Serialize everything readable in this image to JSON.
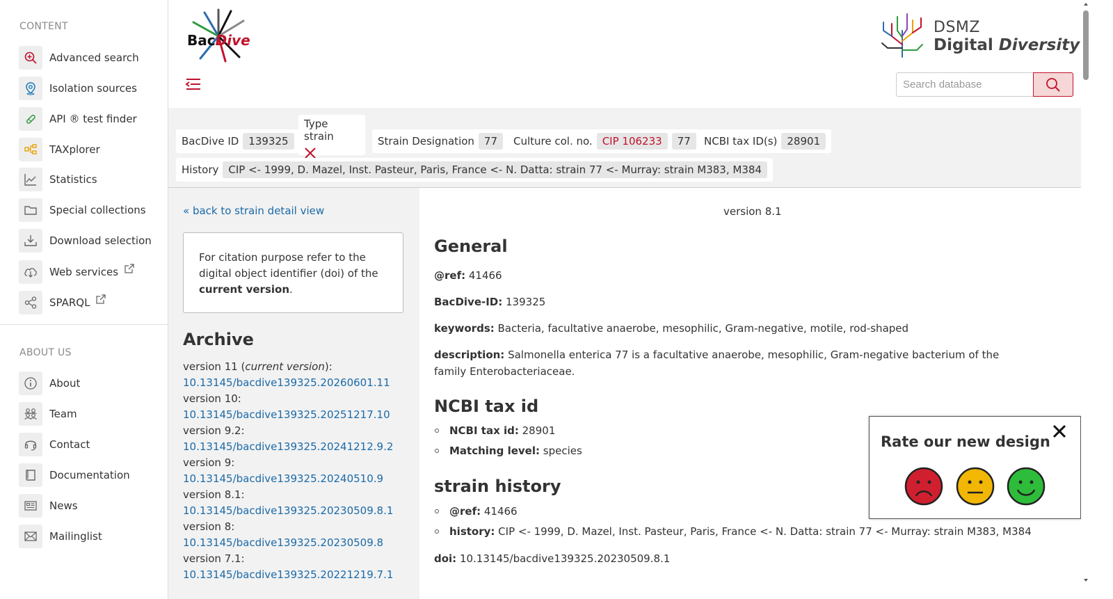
{
  "sidebar": {
    "content_title": "CONTENT",
    "content_items": [
      {
        "label": "Advanced search",
        "icon": "search-plus-icon"
      },
      {
        "label": "Isolation sources",
        "icon": "map-pin-icon"
      },
      {
        "label": "API ® test finder",
        "icon": "test-tube-icon"
      },
      {
        "label": "TAXplorer",
        "icon": "hierarchy-icon"
      },
      {
        "label": "Statistics",
        "icon": "line-chart-icon"
      },
      {
        "label": "Special collections",
        "icon": "folder-icon"
      },
      {
        "label": "Download selection",
        "icon": "download-icon"
      },
      {
        "label": "Web services",
        "icon": "cloud-download-icon"
      },
      {
        "label": "SPARQL",
        "icon": "share-nodes-icon"
      }
    ],
    "about_title": "ABOUT US",
    "about_items": [
      {
        "label": "About",
        "icon": "info-icon"
      },
      {
        "label": "Team",
        "icon": "team-icon"
      },
      {
        "label": "Contact",
        "icon": "headset-icon"
      },
      {
        "label": "Documentation",
        "icon": "book-icon"
      },
      {
        "label": "News",
        "icon": "newspaper-icon"
      },
      {
        "label": "Mailinglist",
        "icon": "envelope-icon"
      }
    ]
  },
  "header": {
    "logo_part1": "Bac",
    "logo_part2": "Dive",
    "dsmz_line1": "DSMZ",
    "dsmz_line2a": "Digital ",
    "dsmz_line2b": "Diversity",
    "search_placeholder": "Search database"
  },
  "strain": {
    "bacdive_id_label": "BacDive ID",
    "bacdive_id": "139325",
    "type_strain_label": "Type strain",
    "designation_label": "Strain Designation",
    "designation": "77",
    "culture_label": "Culture col. no.",
    "culture_no": "CIP 106233",
    "culture_no2": "77",
    "ncbi_label": "NCBI tax ID(s)",
    "ncbi_id": "28901",
    "history_label": "History",
    "history": "CIP <- 1999, D. Mazel, Inst. Pasteur, Paris, France <- N. Datta: strain 77 <- Murray: strain M383, M384"
  },
  "left": {
    "back_link": "« back to strain detail view",
    "cite_text": "For citation purpose refer to the digital object identifier (doi) of the ",
    "cite_bold": "current version",
    "cite_end": ".",
    "archive_title": "Archive",
    "archive": [
      {
        "version": "version 11 (",
        "current": "current version",
        "suffix": "):",
        "doi": "10.13145/bacdive139325.20260601.11"
      },
      {
        "version": "version 10:",
        "doi": "10.13145/bacdive139325.20251217.10"
      },
      {
        "version": "version 9.2:",
        "doi": "10.13145/bacdive139325.20241212.9.2"
      },
      {
        "version": "version 9:",
        "doi": "10.13145/bacdive139325.20240510.9"
      },
      {
        "version": "version 8.1:",
        "doi": "10.13145/bacdive139325.20230509.8.1"
      },
      {
        "version": "version 8:",
        "doi": "10.13145/bacdive139325.20230509.8"
      },
      {
        "version": "version 7.1:",
        "doi": "10.13145/bacdive139325.20221219.7.1"
      }
    ]
  },
  "main": {
    "version_label": "version 8.1",
    "general_title": "General",
    "ref_label": "@ref:",
    "ref_value": " 41466",
    "bacdive_id_label": "BacDive-ID:",
    "bacdive_id_value": " 139325",
    "keywords_label": "keywords:",
    "keywords_value": " Bacteria, facultative anaerobe, mesophilic, Gram-negative, motile, rod-shaped",
    "description_label": "description:",
    "description_value": " Salmonella enterica 77 is a facultative anaerobe, mesophilic, Gram-negative bacterium of the family Enterobacteriaceae.",
    "ncbi_title": "NCBI tax id",
    "ncbi_taxid_label": "NCBI tax id:",
    "ncbi_taxid_value": " 28901",
    "matching_label": "Matching level:",
    "matching_value": " species",
    "history_title": "strain history",
    "hist_ref_label": "@ref:",
    "hist_ref_value": " 41466",
    "hist_label": "history:",
    "hist_value": " CIP <- 1999, D. Mazel, Inst. Pasteur, Paris, France <- N. Datta: strain 77 <- Murray: strain M383, M384",
    "doi_label": "doi:",
    "doi_value": " 10.13145/bacdive139325.20230509.8.1"
  },
  "rating": {
    "title": "Rate our new design"
  },
  "colors": {
    "accent": "#c0122b",
    "link": "#1a6aa8",
    "band": "#f2f2f2"
  }
}
